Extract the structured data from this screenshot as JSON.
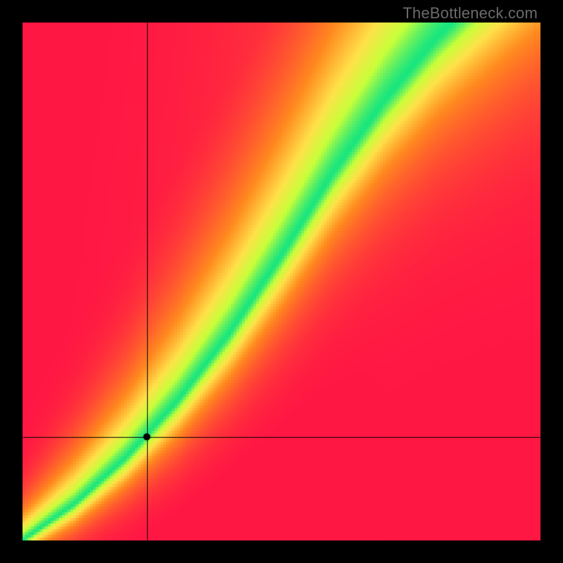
{
  "watermark": "TheBottleneck.com",
  "colors": {
    "bg": "#000000",
    "red": "#ff1744",
    "orange": "#ff8a1f",
    "yellow": "#ffe24a",
    "lime": "#c8ff3a",
    "green": "#18e67f",
    "crosshair": "#000000",
    "point": "#000000"
  },
  "chart_data": {
    "type": "heatmap",
    "title": "",
    "xlabel": "",
    "ylabel": "",
    "xlim": [
      0,
      100
    ],
    "ylim": [
      0,
      100
    ],
    "grid": false,
    "legend": false,
    "crosshair_point": {
      "x": 24,
      "y": 20
    },
    "ridge_curve": {
      "description": "Approximate y for x where value peaks (green band center), normalized 0-100",
      "points": [
        {
          "x": 0,
          "y": 0
        },
        {
          "x": 10,
          "y": 7
        },
        {
          "x": 20,
          "y": 16
        },
        {
          "x": 30,
          "y": 27
        },
        {
          "x": 40,
          "y": 40
        },
        {
          "x": 50,
          "y": 55
        },
        {
          "x": 60,
          "y": 71
        },
        {
          "x": 70,
          "y": 85
        },
        {
          "x": 80,
          "y": 97
        },
        {
          "x": 90,
          "y": 107
        },
        {
          "x": 100,
          "y": 117
        }
      ]
    },
    "ridge_width": {
      "description": "Approximate half-width of green band along x, normalized units",
      "points": [
        {
          "x": 0,
          "w": 1.0
        },
        {
          "x": 20,
          "w": 2.0
        },
        {
          "x": 40,
          "w": 3.5
        },
        {
          "x": 60,
          "w": 5.0
        },
        {
          "x": 80,
          "w": 6.5
        },
        {
          "x": 100,
          "w": 8.0
        }
      ]
    },
    "color_scale": {
      "description": "Value 0 (furthest from ridge) to 1 (on ridge)",
      "stops": [
        {
          "v": 0.0,
          "color": "#ff1744"
        },
        {
          "v": 0.45,
          "color": "#ff8a1f"
        },
        {
          "v": 0.7,
          "color": "#ffe24a"
        },
        {
          "v": 0.86,
          "color": "#c8ff3a"
        },
        {
          "v": 1.0,
          "color": "#18e67f"
        }
      ]
    }
  }
}
